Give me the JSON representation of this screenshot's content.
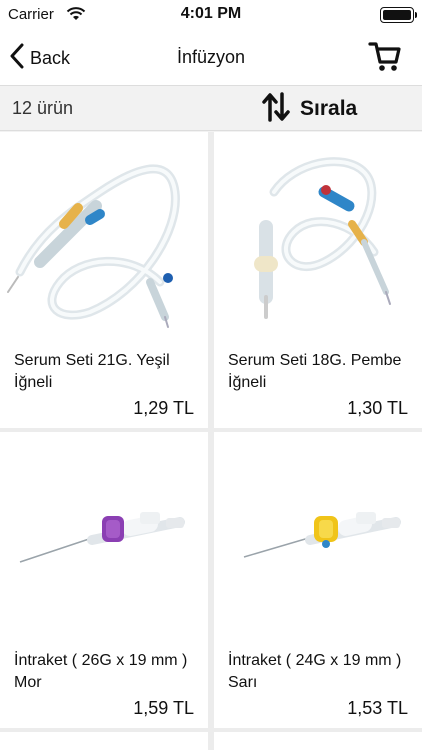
{
  "status": {
    "carrier": "Carrier",
    "time": "4:01 PM"
  },
  "nav": {
    "back_label": "Back",
    "title": "İnfüzyon"
  },
  "bar": {
    "count": "12 ürün",
    "sort_label": "Sırala"
  },
  "products": [
    {
      "name": "Serum Seti 21G. Yeşil İğneli",
      "price": "1,29 TL",
      "image_icon": "infusion-set-image"
    },
    {
      "name": "Serum Seti 18G. Pembe İğneli",
      "price": "1,30 TL",
      "image_icon": "infusion-set-image"
    },
    {
      "name": "İntraket ( 26G x 19 mm ) Mor",
      "price": "1,59 TL",
      "image_icon": "iv-cannula-purple-image"
    },
    {
      "name": "İntraket ( 24G x 19 mm ) Sarı",
      "price": "1,53 TL",
      "image_icon": "iv-cannula-yellow-image"
    }
  ]
}
